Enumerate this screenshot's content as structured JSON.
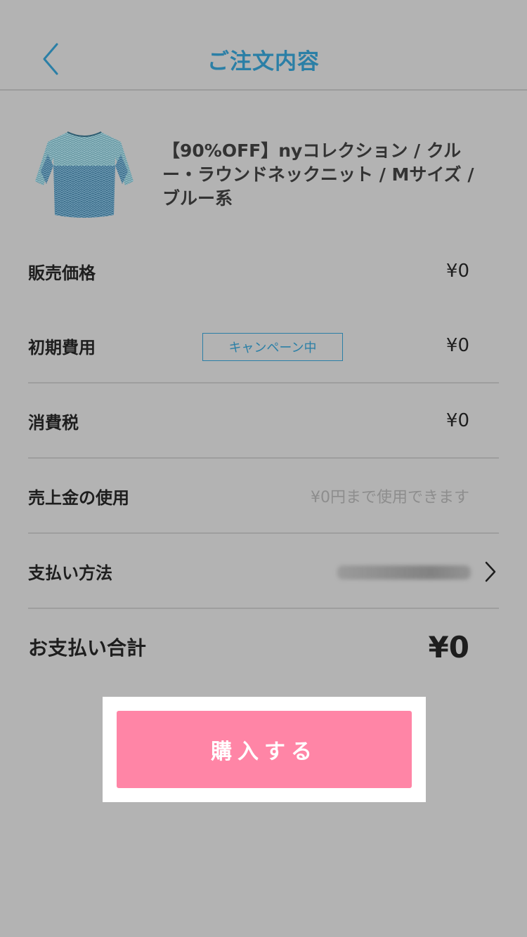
{
  "header": {
    "title": "ご注文内容"
  },
  "product": {
    "title": "【90%OFF】nyコレクション / クルー・ラウンドネックニット / Mサイズ / ブルー系",
    "image_icon": "sweater-image"
  },
  "rows": {
    "price": {
      "label": "販売価格",
      "value": "¥0"
    },
    "initial_fee": {
      "label": "初期費用",
      "badge": "キャンペーン中",
      "value": "¥0"
    },
    "tax": {
      "label": "消費税",
      "value": "¥0"
    },
    "sales_balance": {
      "label": "売上金の使用",
      "hint": "¥0円まで使用できます"
    },
    "payment_method": {
      "label": "支払い方法",
      "icon": "chevron-right-icon"
    },
    "total": {
      "label": "お支払い合計",
      "value": "¥0"
    }
  },
  "actions": {
    "purchase_label": "購入する"
  },
  "colors": {
    "background": "#b3b3b3",
    "accent": "#2b7fa6",
    "purchase_button": "#ff85a6"
  }
}
